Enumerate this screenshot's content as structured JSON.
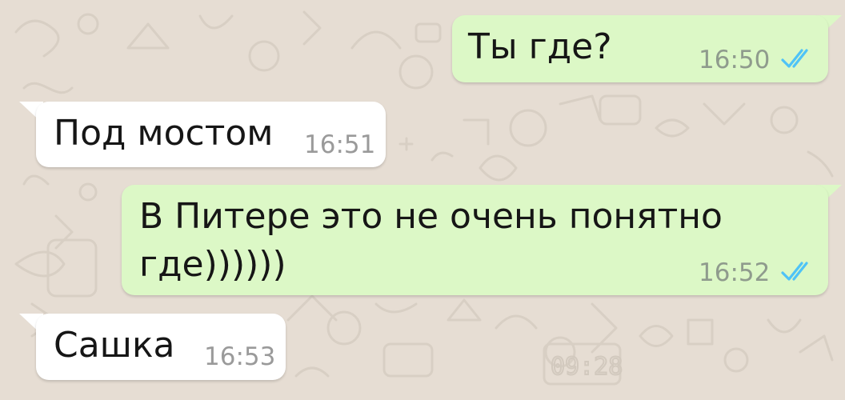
{
  "chat": {
    "messages": [
      {
        "direction": "outgoing",
        "text": "Ты где?",
        "time": "16:50",
        "status_icon": "double-check-read-icon"
      },
      {
        "direction": "incoming",
        "text": "Под мостом",
        "time": "16:51"
      },
      {
        "direction": "outgoing",
        "text": "В Питере это не очень понятно\nгде))))))",
        "time": "16:52",
        "status_icon": "double-check-read-icon"
      },
      {
        "direction": "incoming",
        "text": "Сашка",
        "time": "16:53"
      }
    ]
  },
  "colors": {
    "wallpaper": "#e6ddd3",
    "outgoing_bubble": "#dcf8c6",
    "incoming_bubble": "#ffffff",
    "read_ticks": "#4fc3f7"
  },
  "wallpaper_doodle_text": "09:28"
}
